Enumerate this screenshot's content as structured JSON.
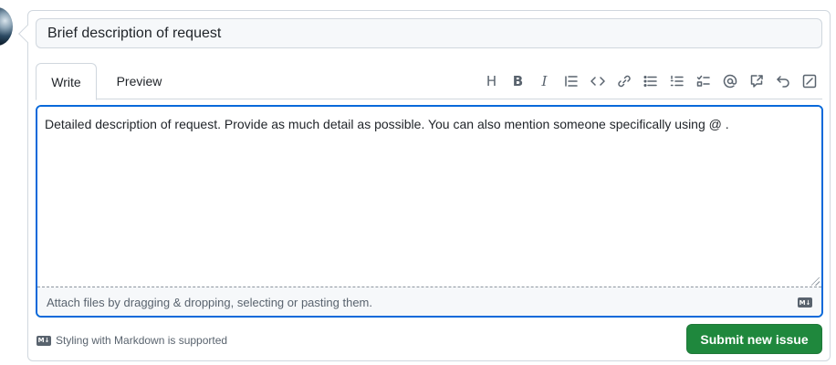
{
  "issue_form": {
    "title_value": "Brief description of request",
    "tabs": [
      {
        "label": "Write"
      },
      {
        "label": "Preview"
      }
    ],
    "toolbar": {
      "heading": "H",
      "bold": "B",
      "italic": "I"
    },
    "body_value": "Detailed description of request. Provide as much detail as possible. You can also mention someone specifically using @ .",
    "attach_hint": "Attach files by dragging & dropping, selecting or pasting them.",
    "markdown_note": "Styling with Markdown is supported",
    "markdown_badge": "M↓",
    "submit_label": "Submit new issue"
  },
  "colors": {
    "accent_focus": "#0969da",
    "submit_green": "#1f883d",
    "border": "#d0d7de",
    "muted_text": "#59636e"
  },
  "icons": [
    "avatar-image",
    "heading-icon",
    "bold-icon",
    "italic-icon",
    "quote-icon",
    "code-icon",
    "link-icon",
    "unordered-list-icon",
    "ordered-list-icon",
    "task-list-icon",
    "mention-icon",
    "cross-reference-icon",
    "undo-icon",
    "slash-command-icon",
    "markdown-icon"
  ]
}
